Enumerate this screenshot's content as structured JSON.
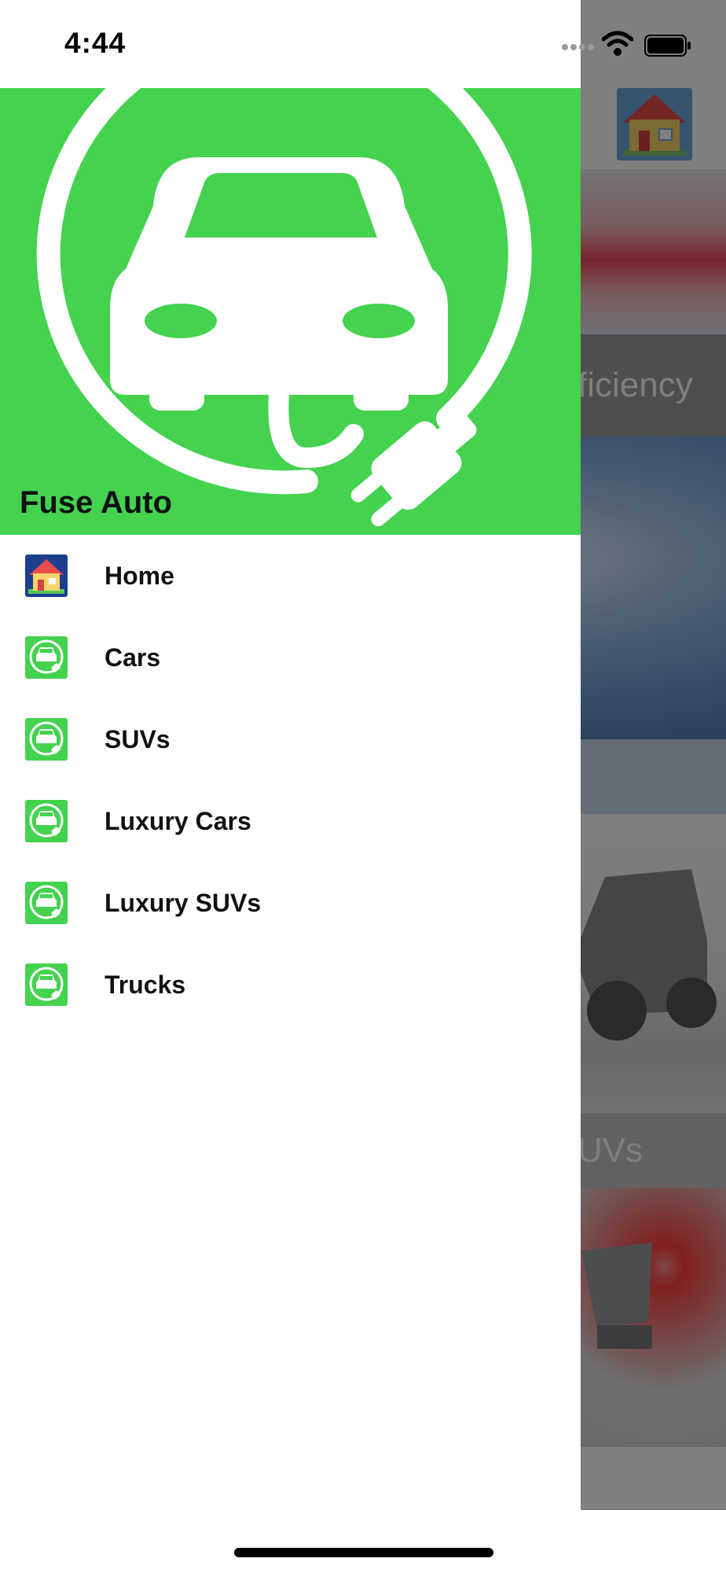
{
  "status_bar": {
    "time": "4:44"
  },
  "background": {
    "cards": [
      {
        "caption": "ficiency"
      },
      {
        "caption": ""
      },
      {
        "caption": "UVs"
      },
      {
        "caption": ""
      }
    ]
  },
  "drawer": {
    "header": {
      "title": "Fuse Auto",
      "color": "#44d24f"
    },
    "items": [
      {
        "label": "Home",
        "icon": "house-icon"
      },
      {
        "label": "Cars",
        "icon": "ev-car-plug-icon"
      },
      {
        "label": "SUVs",
        "icon": "ev-car-plug-icon"
      },
      {
        "label": "Luxury Cars",
        "icon": "ev-car-plug-icon"
      },
      {
        "label": "Luxury SUVs",
        "icon": "ev-car-plug-icon"
      },
      {
        "label": "Trucks",
        "icon": "ev-car-plug-icon"
      }
    ]
  }
}
